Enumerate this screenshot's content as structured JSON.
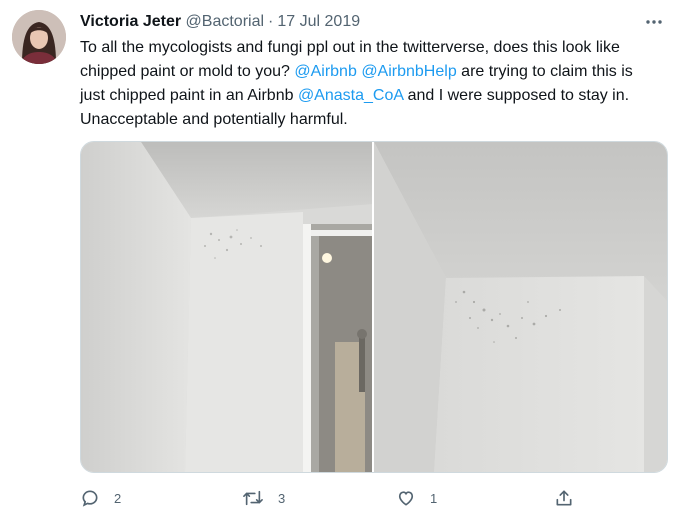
{
  "tweet": {
    "author_name": "Victoria Jeter",
    "handle": "@Bactorial",
    "separator": "·",
    "date": "17 Jul 2019",
    "text_parts": {
      "p1": "To all the mycologists and fungi ppl out in the twitterverse, does this look like chipped paint or mold to you? ",
      "m1": "@Airbnb",
      "p2": " ",
      "m2": "@AirbnbHelp",
      "p3": " are trying to claim this is just chipped paint in an Airbnb ",
      "m3": "@Anasta_CoA",
      "p4": " and I were supposed to stay in. Unacceptable and potentially harmful."
    }
  },
  "actions": {
    "reply_count": "2",
    "retweet_count": "3",
    "like_count": "1"
  },
  "icons": {
    "more": "more-dots-icon",
    "reply": "reply-icon",
    "retweet": "retweet-icon",
    "like": "heart-icon",
    "share": "share-icon"
  },
  "colors": {
    "mention": "#1d9bf0",
    "muted": "#536471",
    "text": "#0f1419"
  }
}
